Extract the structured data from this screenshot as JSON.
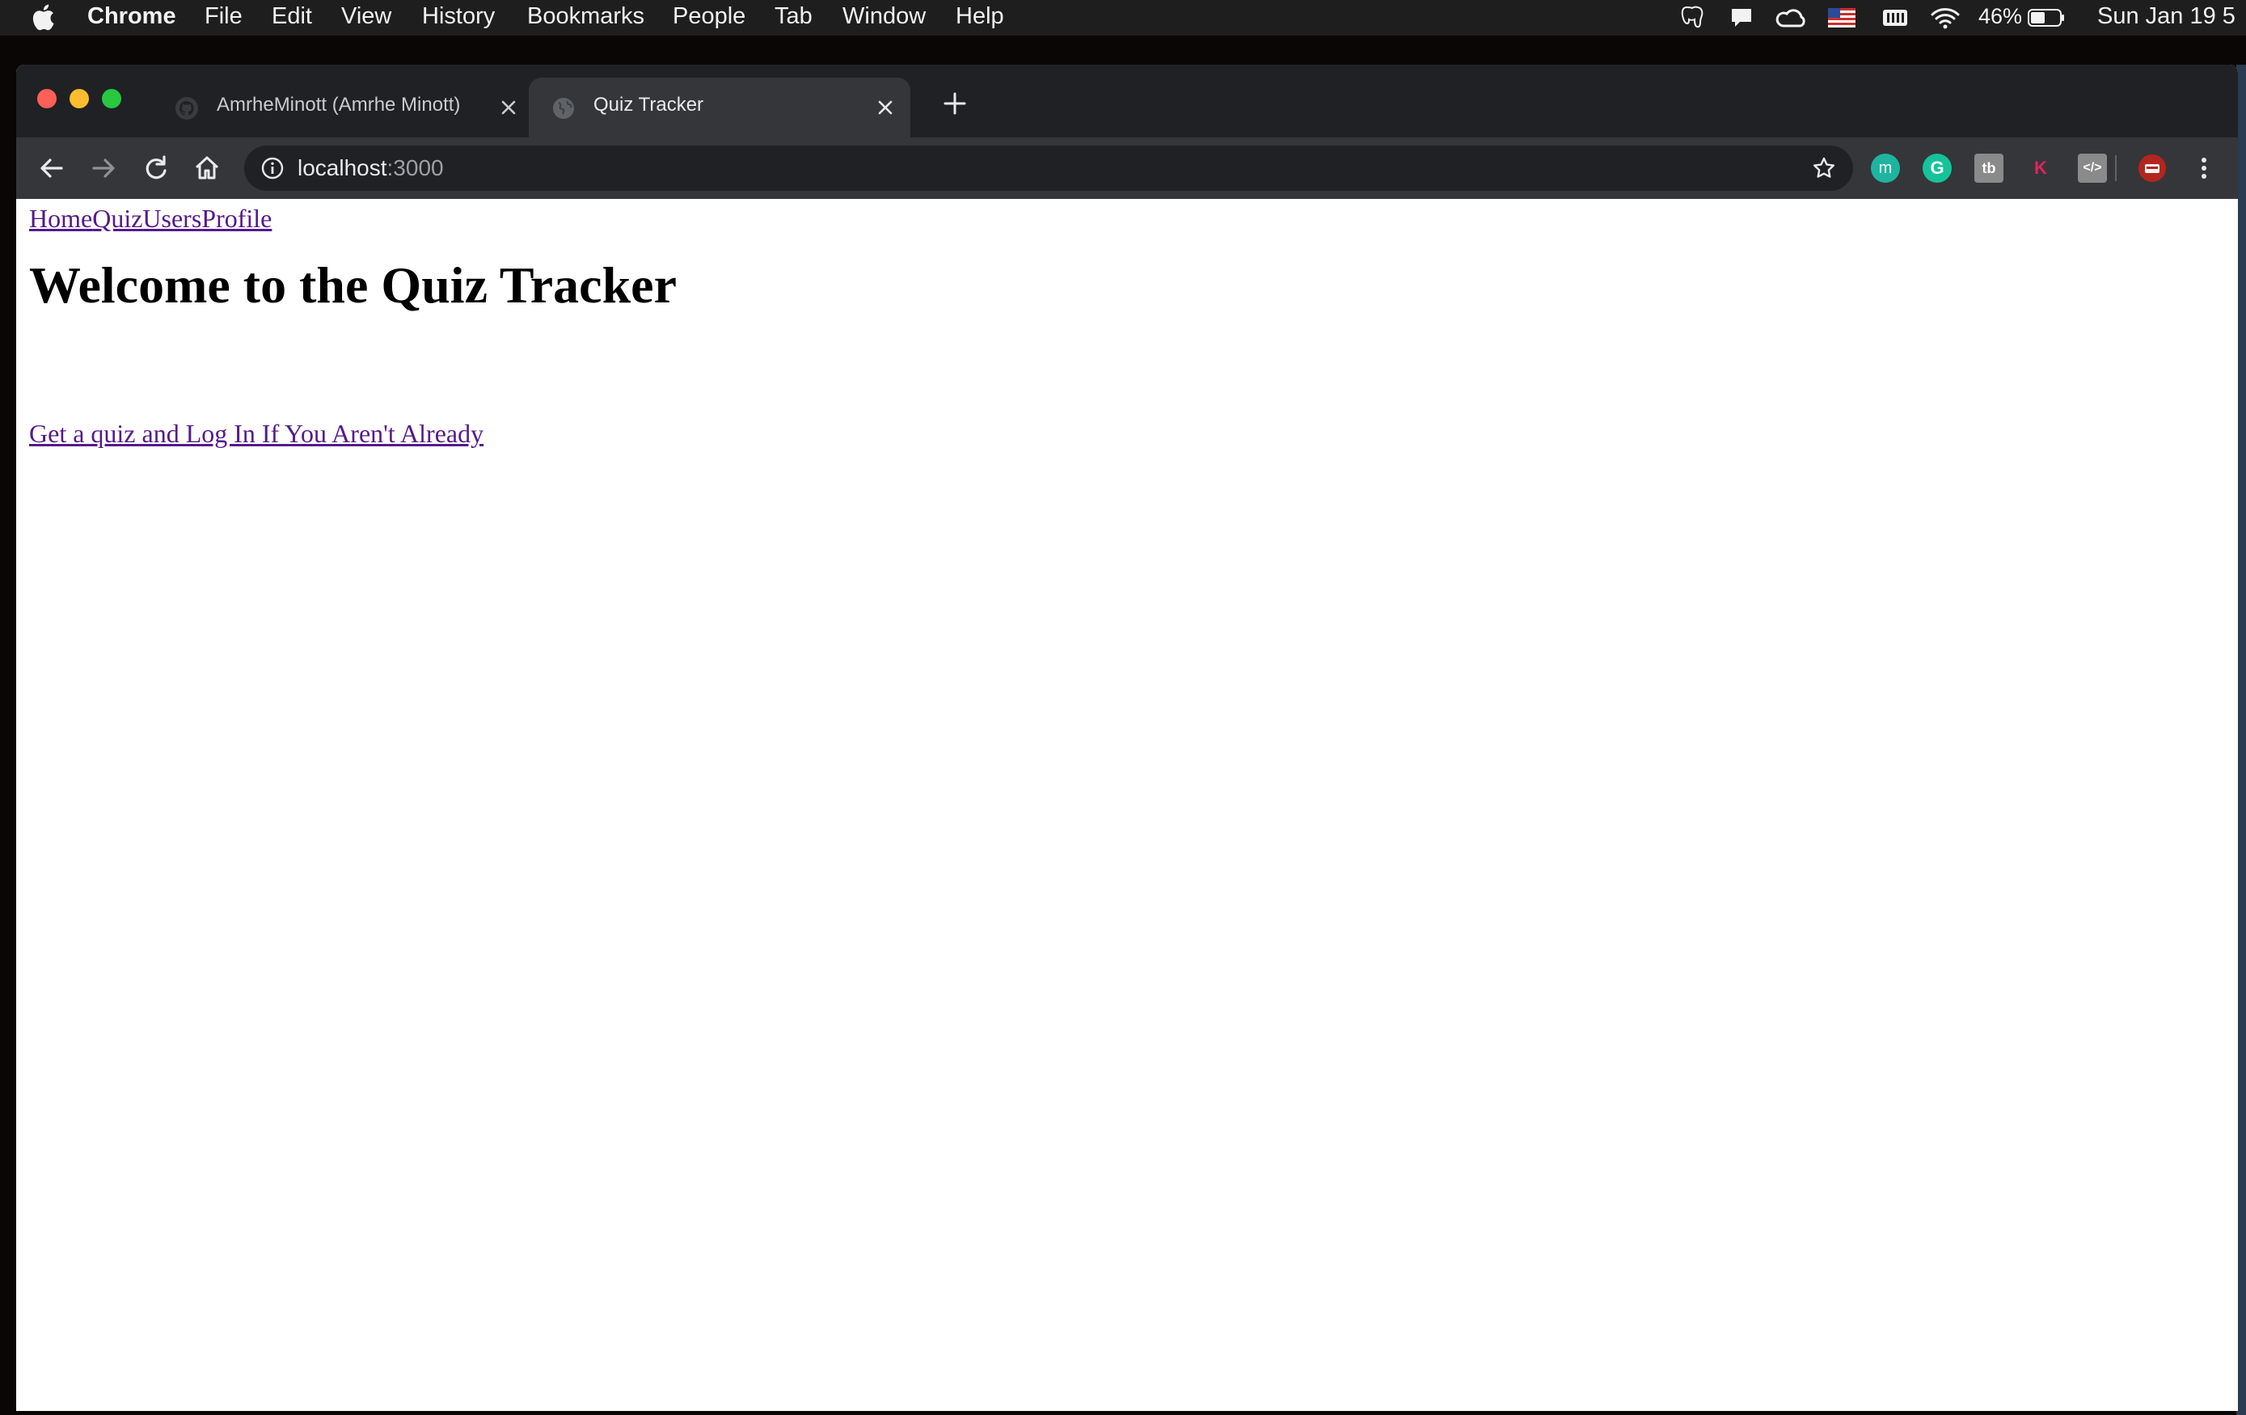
{
  "menubar": {
    "app_name": "Chrome",
    "items": [
      "File",
      "Edit",
      "View",
      "History",
      "Bookmarks",
      "People",
      "Tab",
      "Window",
      "Help"
    ],
    "battery_percent": "46%",
    "clock": "Sun Jan 19  5"
  },
  "browser": {
    "tabs": [
      {
        "title": "AmrheMinott (Amrhe Minott)",
        "icon": "github-icon",
        "active": false
      },
      {
        "title": "Quiz Tracker",
        "icon": "globe-icon",
        "active": true
      }
    ],
    "address": {
      "host": "localhost",
      "port": ":3000"
    },
    "extensions": [
      {
        "name": "mint-extension-icon",
        "label": "m",
        "color": "#1db5a0"
      },
      {
        "name": "grammarly-icon",
        "label": "G",
        "color": "#15c39a"
      },
      {
        "name": "tb-extension-icon",
        "label": "tb",
        "color": "#8a8a8a"
      },
      {
        "name": "k-extension-icon",
        "label": "K",
        "color": "#e0245e"
      },
      {
        "name": "code-extension-icon",
        "label": "</>",
        "color": "#8a8a8a"
      }
    ]
  },
  "page": {
    "nav": [
      "Home",
      "Quiz",
      "Users",
      "Profile"
    ],
    "heading": "Welcome to the Quiz Tracker",
    "link": "Get a quiz and Log In If You Aren't Already"
  },
  "colors": {
    "link": "#551a8b",
    "tabstrip": "#202124",
    "toolbar": "#35363a"
  }
}
